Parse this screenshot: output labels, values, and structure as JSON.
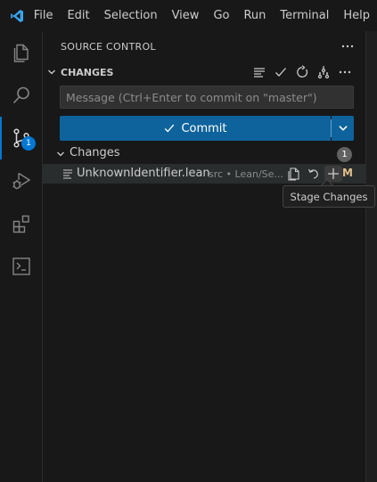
{
  "menu": {
    "items": [
      "File",
      "Edit",
      "Selection",
      "View",
      "Go",
      "Run",
      "Terminal",
      "Help"
    ]
  },
  "activity_bar": {
    "items": [
      {
        "icon": "files-icon",
        "label": "Explorer"
      },
      {
        "icon": "search-icon",
        "label": "Search"
      },
      {
        "icon": "source-control-icon",
        "label": "Source Control",
        "badge": "1",
        "active": true
      },
      {
        "icon": "run-debug-icon",
        "label": "Run and Debug"
      },
      {
        "icon": "extensions-icon",
        "label": "Extensions"
      },
      {
        "icon": "terminal-icon",
        "label": "Terminal"
      }
    ]
  },
  "sidebar": {
    "title": "SOURCE CONTROL",
    "section": {
      "title": "CHANGES"
    },
    "message_input": {
      "placeholder": "Message (Ctrl+Enter to commit on \"master\")",
      "value": ""
    },
    "commit_button": {
      "label": "Commit"
    },
    "changes_group": {
      "label": "Changes",
      "count": "1",
      "files": [
        {
          "name": "UnknownIdentifier.lean",
          "description": "src • Lean/Se...",
          "status": "M"
        }
      ]
    }
  },
  "tooltip": {
    "text": "Stage Changes"
  },
  "colors": {
    "accent": "#0078d4",
    "commit_button": "#0e639c",
    "modified_status": "#e2c08d",
    "background": "#181818"
  }
}
